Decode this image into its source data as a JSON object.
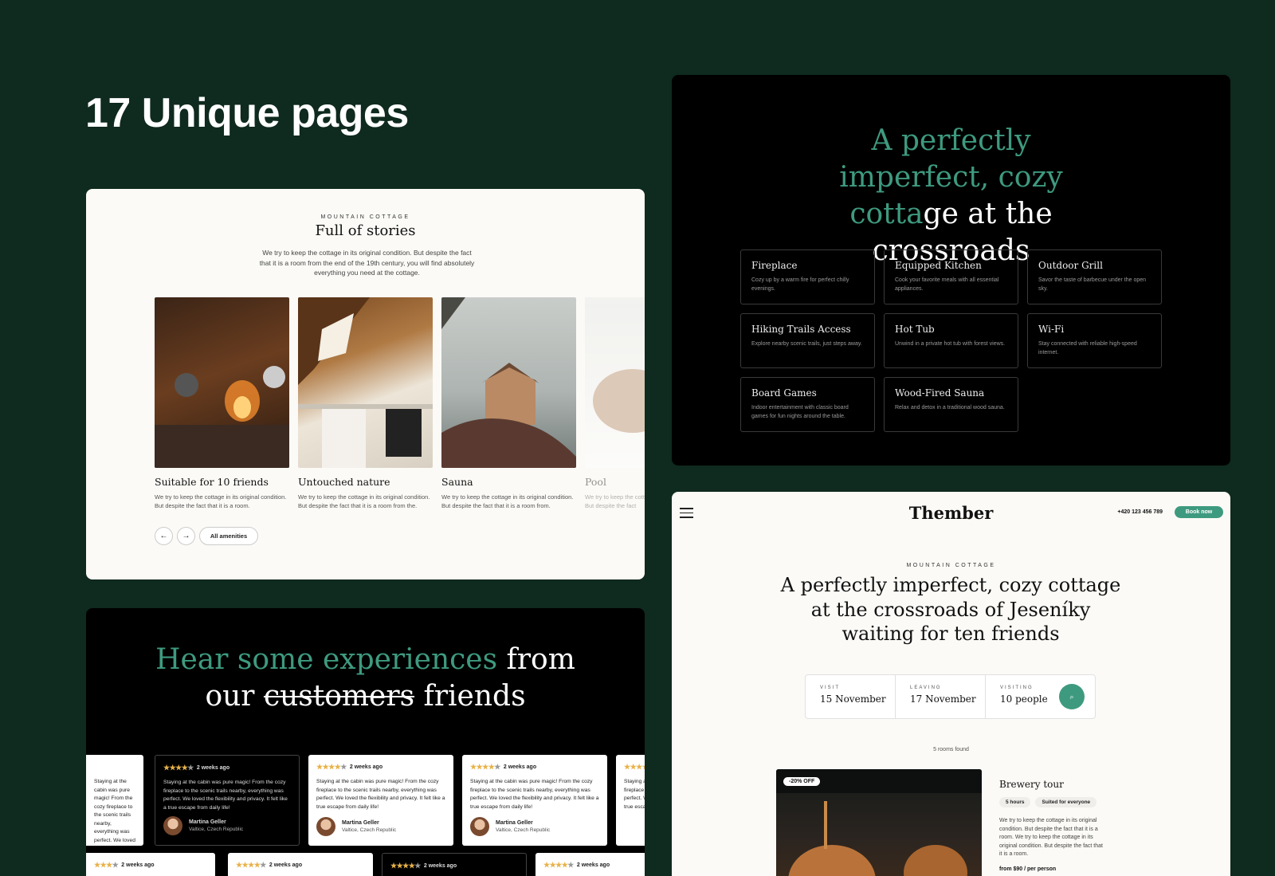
{
  "hero": {
    "title": "17 Unique pages"
  },
  "stories": {
    "eyebrow": "MOUNTAIN COTTAGE",
    "title": "Full of stories",
    "description": "We try to keep the cottage in its original condition. But despite the fact that it is a room from the end of the 19th century, you will find absolutely everything you need at the cottage.",
    "cards": [
      {
        "title": "Suitable for 10 friends",
        "desc": "We try to keep the cottage in its original condition. But despite the fact that it is a room."
      },
      {
        "title": "Untouched nature",
        "desc": "We try to keep the cottage in its original condition. But despite the fact that it is a room from the."
      },
      {
        "title": "Sauna",
        "desc": "We try to keep the cottage in its original condition. But despite the fact that it is a room from."
      },
      {
        "title": "Pool",
        "desc": "We try to keep the cottage in its original condition. But despite the fact"
      }
    ],
    "all_amenities_label": "All amenities"
  },
  "amenities": {
    "headline_green": "A perfectly imperfect, cozy cotta",
    "headline_white": "ge at the crossroads",
    "items": [
      {
        "title": "Fireplace",
        "desc": "Cozy up by a warm fire for perfect chilly evenings."
      },
      {
        "title": "Equipped Kitchen",
        "desc": "Cook your favorite meals with all essential appliances."
      },
      {
        "title": "Outdoor Grill",
        "desc": "Savor the taste of barbecue under the open sky."
      },
      {
        "title": "Hiking Trails Access",
        "desc": "Explore nearby scenic trails, just steps away."
      },
      {
        "title": "Hot Tub",
        "desc": "Unwind in a private hot tub with forest views."
      },
      {
        "title": "Wi-Fi",
        "desc": "Stay connected with reliable high-speed internet."
      },
      {
        "title": "Board Games",
        "desc": "Indoor entertainment with classic board games for fun nights around the table."
      },
      {
        "title": "Wood-Fired Sauna",
        "desc": "Relax and detox in a traditional wood sauna."
      }
    ]
  },
  "reviews": {
    "headline_green": "Hear some experiences",
    "headline_white_1": " from",
    "headline_white_2": "our ",
    "headline_strike": "customers",
    "headline_white_3": " friends",
    "time": "2 weeks ago",
    "text": "Staying at the cabin was pure magic! From the cozy fireplace to the scenic trails nearby, everything was perfect. We loved the flexibility and privacy. It felt like a true escape from daily life!",
    "author": "Martina Geller",
    "location": "Valtice, Czech Republic",
    "colors": {
      "star": "#e8b24a"
    }
  },
  "booking": {
    "logo": "Thember",
    "phone": "+420 123 456 789",
    "book_label": "Book now",
    "eyebrow": "MOUNTAIN COTTAGE",
    "headline": "A perfectly imperfect, cozy cottage at the crossroads of Jeseníky waiting for ten friends",
    "search": {
      "visit_label": "VISIT",
      "visit_value": "15 November",
      "leaving_label": "LEAVING",
      "leaving_value": "17 November",
      "visiting_label": "VISITING",
      "visiting_value": "10 people"
    },
    "rooms_found": "5 rooms found",
    "room": {
      "discount": "-20% OFF",
      "title": "Brewery tour",
      "tags": [
        "5 hours",
        "Suited for everyone"
      ],
      "desc": "We try to keep the cottage in its original condition. But despite the fact that it is a room. We try to keep the cottage in its original condition. But despite the fact that it is a room.",
      "price": "from $90 / per person"
    },
    "colors": {
      "accent": "#3e9a7f"
    }
  }
}
